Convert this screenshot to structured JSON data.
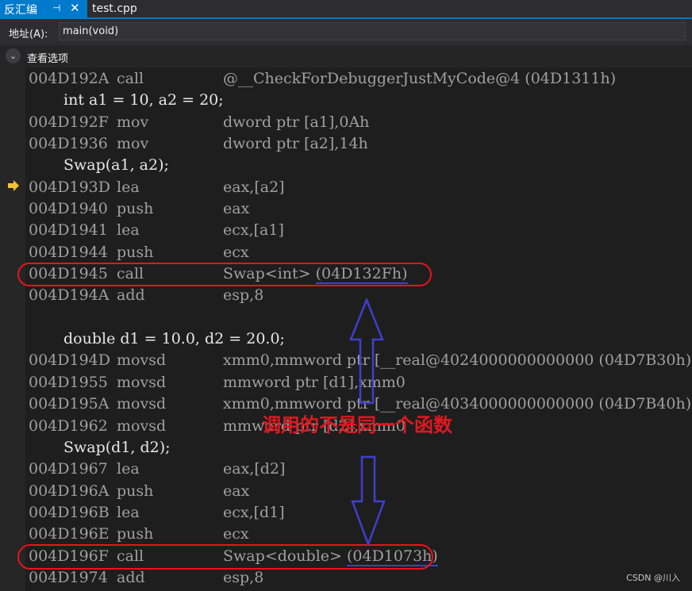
{
  "tabs": [
    {
      "label": "反汇编",
      "pin": "⊣",
      "close": "✕"
    },
    {
      "label": "test.cpp"
    }
  ],
  "address": {
    "label": "地址(A):",
    "value": "main(void)"
  },
  "options": {
    "label": "查看选项"
  },
  "lines": [
    {
      "addr": "004D192A",
      "op": "call",
      "arg": "@__CheckForDebuggerJustMyCode@4 (04D1311h)"
    },
    {
      "src": "int a1 = 10, a2 = 20;"
    },
    {
      "addr": "004D192F",
      "op": "mov",
      "arg": "dword ptr [a1],0Ah"
    },
    {
      "addr": "004D1936",
      "op": "mov",
      "arg": "dword ptr [a2],14h"
    },
    {
      "src": "Swap(a1, a2);"
    },
    {
      "addr": "004D193D",
      "op": "lea",
      "arg": "eax,[a2]"
    },
    {
      "addr": "004D1940",
      "op": "push",
      "arg": "eax"
    },
    {
      "addr": "004D1941",
      "op": "lea",
      "arg": "ecx,[a1]"
    },
    {
      "addr": "004D1944",
      "op": "push",
      "arg": "ecx"
    },
    {
      "addr": "004D1945",
      "op": "call",
      "arg": "Swap<int> ",
      "target": "(04D132Fh)"
    },
    {
      "addr": "004D194A",
      "op": "add",
      "arg": "esp,8"
    },
    {
      "src": ""
    },
    {
      "src": "double d1 = 10.0, d2 = 20.0;"
    },
    {
      "addr": "004D194D",
      "op": "movsd",
      "arg": "xmm0,mmword ptr [__real@4024000000000000 (04D7B30h)]"
    },
    {
      "addr": "004D1955",
      "op": "movsd",
      "arg": "mmword ptr [d1],xmm0"
    },
    {
      "addr": "004D195A",
      "op": "movsd",
      "arg": "xmm0,mmword ptr [__real@4034000000000000 (04D7B40h)]"
    },
    {
      "addr": "004D1962",
      "op": "movsd",
      "arg": "mmword ptr [d2],xmm0"
    },
    {
      "src": "Swap(d1, d2);"
    },
    {
      "addr": "004D1967",
      "op": "lea",
      "arg": "eax,[d2]"
    },
    {
      "addr": "004D196A",
      "op": "push",
      "arg": "eax"
    },
    {
      "addr": "004D196B",
      "op": "lea",
      "arg": "ecx,[d1]"
    },
    {
      "addr": "004D196E",
      "op": "push",
      "arg": "ecx"
    },
    {
      "addr": "004D196F",
      "op": "call",
      "arg": "Swap<double> ",
      "target": "(04D1073h)"
    },
    {
      "addr": "004D1974",
      "op": "add",
      "arg": "esp,8"
    }
  ],
  "annotation": {
    "text": "调用的不是同一个函数",
    "color": "#e0181f"
  },
  "watermark": "CSDN @川入",
  "colors": {
    "accent": "#007acc",
    "highlight": "#e8141c",
    "arrow": "#3f3fcf",
    "ip_arrow": "#f2c330"
  }
}
